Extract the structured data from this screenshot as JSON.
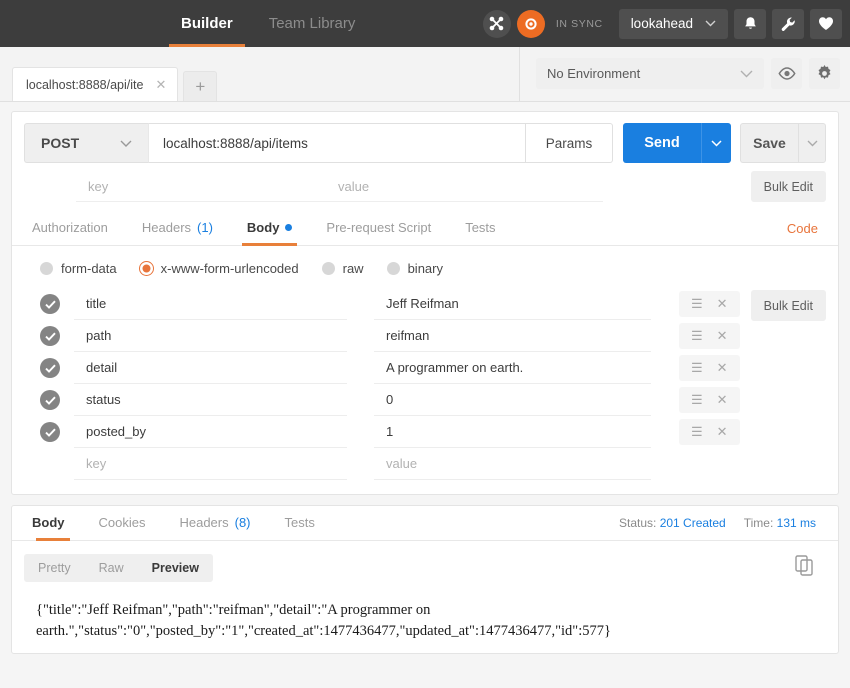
{
  "topbar": {
    "tabs": [
      {
        "label": "Builder",
        "active": true
      },
      {
        "label": "Team Library",
        "active": false
      }
    ],
    "interceptor_icon": "interceptor-icon",
    "sync_icon": "sync-icon",
    "sync_status": "IN SYNC",
    "user": "lookahead",
    "bell_icon": "bell-icon",
    "wrench_icon": "wrench-icon",
    "heart_icon": "heart-icon"
  },
  "tabstrip": {
    "request_tab": "localhost:8888/api/ite",
    "close_label": "✕",
    "new_tab_label": "+",
    "environment": "No Environment",
    "eye_icon": "eye-icon",
    "gear_icon": "gear-icon"
  },
  "request": {
    "method": "POST",
    "url": "localhost:8888/api/items",
    "params_label": "Params",
    "send_label": "Send",
    "save_label": "Save",
    "params_key_placeholder": "key",
    "params_value_placeholder": "value",
    "bulk_edit_label": "Bulk Edit",
    "tabs": [
      {
        "label": "Authorization",
        "active": false,
        "count": "",
        "dot": false
      },
      {
        "label": "Headers",
        "active": false,
        "count": "(1)",
        "dot": false
      },
      {
        "label": "Body",
        "active": true,
        "count": "",
        "dot": true
      },
      {
        "label": "Pre-request Script",
        "active": false,
        "count": "",
        "dot": false
      },
      {
        "label": "Tests",
        "active": false,
        "count": "",
        "dot": false
      }
    ],
    "code_link": "Code",
    "body_types": [
      {
        "label": "form-data",
        "selected": false
      },
      {
        "label": "x-www-form-urlencoded",
        "selected": true
      },
      {
        "label": "raw",
        "selected": false
      },
      {
        "label": "binary",
        "selected": false
      }
    ],
    "form_rows": [
      {
        "checked": true,
        "key": "title",
        "value": "Jeff Reifman"
      },
      {
        "checked": true,
        "key": "path",
        "value": "reifman"
      },
      {
        "checked": true,
        "key": "detail",
        "value": "A programmer on earth."
      },
      {
        "checked": true,
        "key": "status",
        "value": "0"
      },
      {
        "checked": true,
        "key": "posted_by",
        "value": "1"
      }
    ],
    "form_empty_row": {
      "key": "key",
      "value": "value"
    },
    "form_bulk_edit_label": "Bulk Edit",
    "row_menu_icon": "hamburger-icon",
    "row_delete_icon": "close-icon"
  },
  "response": {
    "tabs": [
      {
        "label": "Body",
        "active": true,
        "count": ""
      },
      {
        "label": "Cookies",
        "active": false,
        "count": ""
      },
      {
        "label": "Headers",
        "active": false,
        "count": "(8)"
      },
      {
        "label": "Tests",
        "active": false,
        "count": ""
      }
    ],
    "status_label": "Status:",
    "status_value": "201 Created",
    "time_label": "Time:",
    "time_value": "131 ms",
    "view_modes": [
      {
        "label": "Pretty",
        "active": false
      },
      {
        "label": "Raw",
        "active": false
      },
      {
        "label": "Preview",
        "active": true
      }
    ],
    "copy_icon": "copy-icon",
    "body_text": "{\"title\":\"Jeff Reifman\",\"path\":\"reifman\",\"detail\":\"A programmer on earth.\",\"status\":\"0\",\"posted_by\":\"1\",\"created_at\":1477436477,\"updated_at\":1477436477,\"id\":577}"
  },
  "colors": {
    "accent_orange": "#e8803a",
    "accent_blue": "#1a7fe0",
    "dark_bar": "#3d3d3d",
    "sync_orange": "#ed6c23"
  }
}
